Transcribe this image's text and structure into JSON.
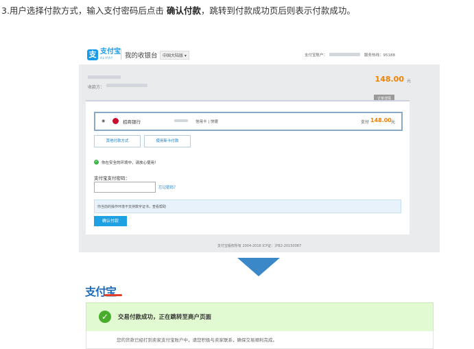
{
  "intro": {
    "prefix": "3.用户选择付款方式，输入支付密码后点击 ",
    "emphasis": "确认付款",
    "suffix": "，跳转到付款成功页后则表示付款成功。"
  },
  "cashier": {
    "logo_glyph": "支",
    "logo_text": "支付宝",
    "logo_sub": "ALIPAY",
    "title": "我的收银台",
    "region": "中国大陆版 ▾",
    "account_label": "支付宝账户：",
    "hotline": "服务热线：95188",
    "order_label": "收款方：",
    "amount": "148.00",
    "amount_unit": "元",
    "detail_button": "订单详情",
    "method": {
      "radio": "◉",
      "bank_name": "招商银行",
      "card_type": "信用卡 | 快捷",
      "pay_label": "支付",
      "pay_amount": "148.00",
      "pay_unit": "元"
    },
    "other_method_button": "其他付款方式",
    "new_card_button": "使用新卡付款",
    "safe_text": "你在安全的环境中，请放心使用！",
    "password_label": "支付宝支付密码：",
    "forgot_link": "忘记密码？",
    "cert_notice": "你当前的操作环境不支持数字证书，查看帮助",
    "confirm_button": "确认付款",
    "copyright": "支付宝版权所有 2004-2016 ICP证：沪B2-20150087"
  },
  "success": {
    "logo": "支付宝",
    "check": "✓",
    "title": "交易付款成功，正在跳转至商户页面",
    "note": "您的货款已经打到卖家支付宝账户中，请您积极与卖家联系，确保交易顺利完成。"
  },
  "colors": {
    "alipay_blue": "#1a9be8",
    "amount_orange": "#f08200",
    "success_green": "#48ad2a",
    "arrow_blue": "#3a88c8"
  }
}
